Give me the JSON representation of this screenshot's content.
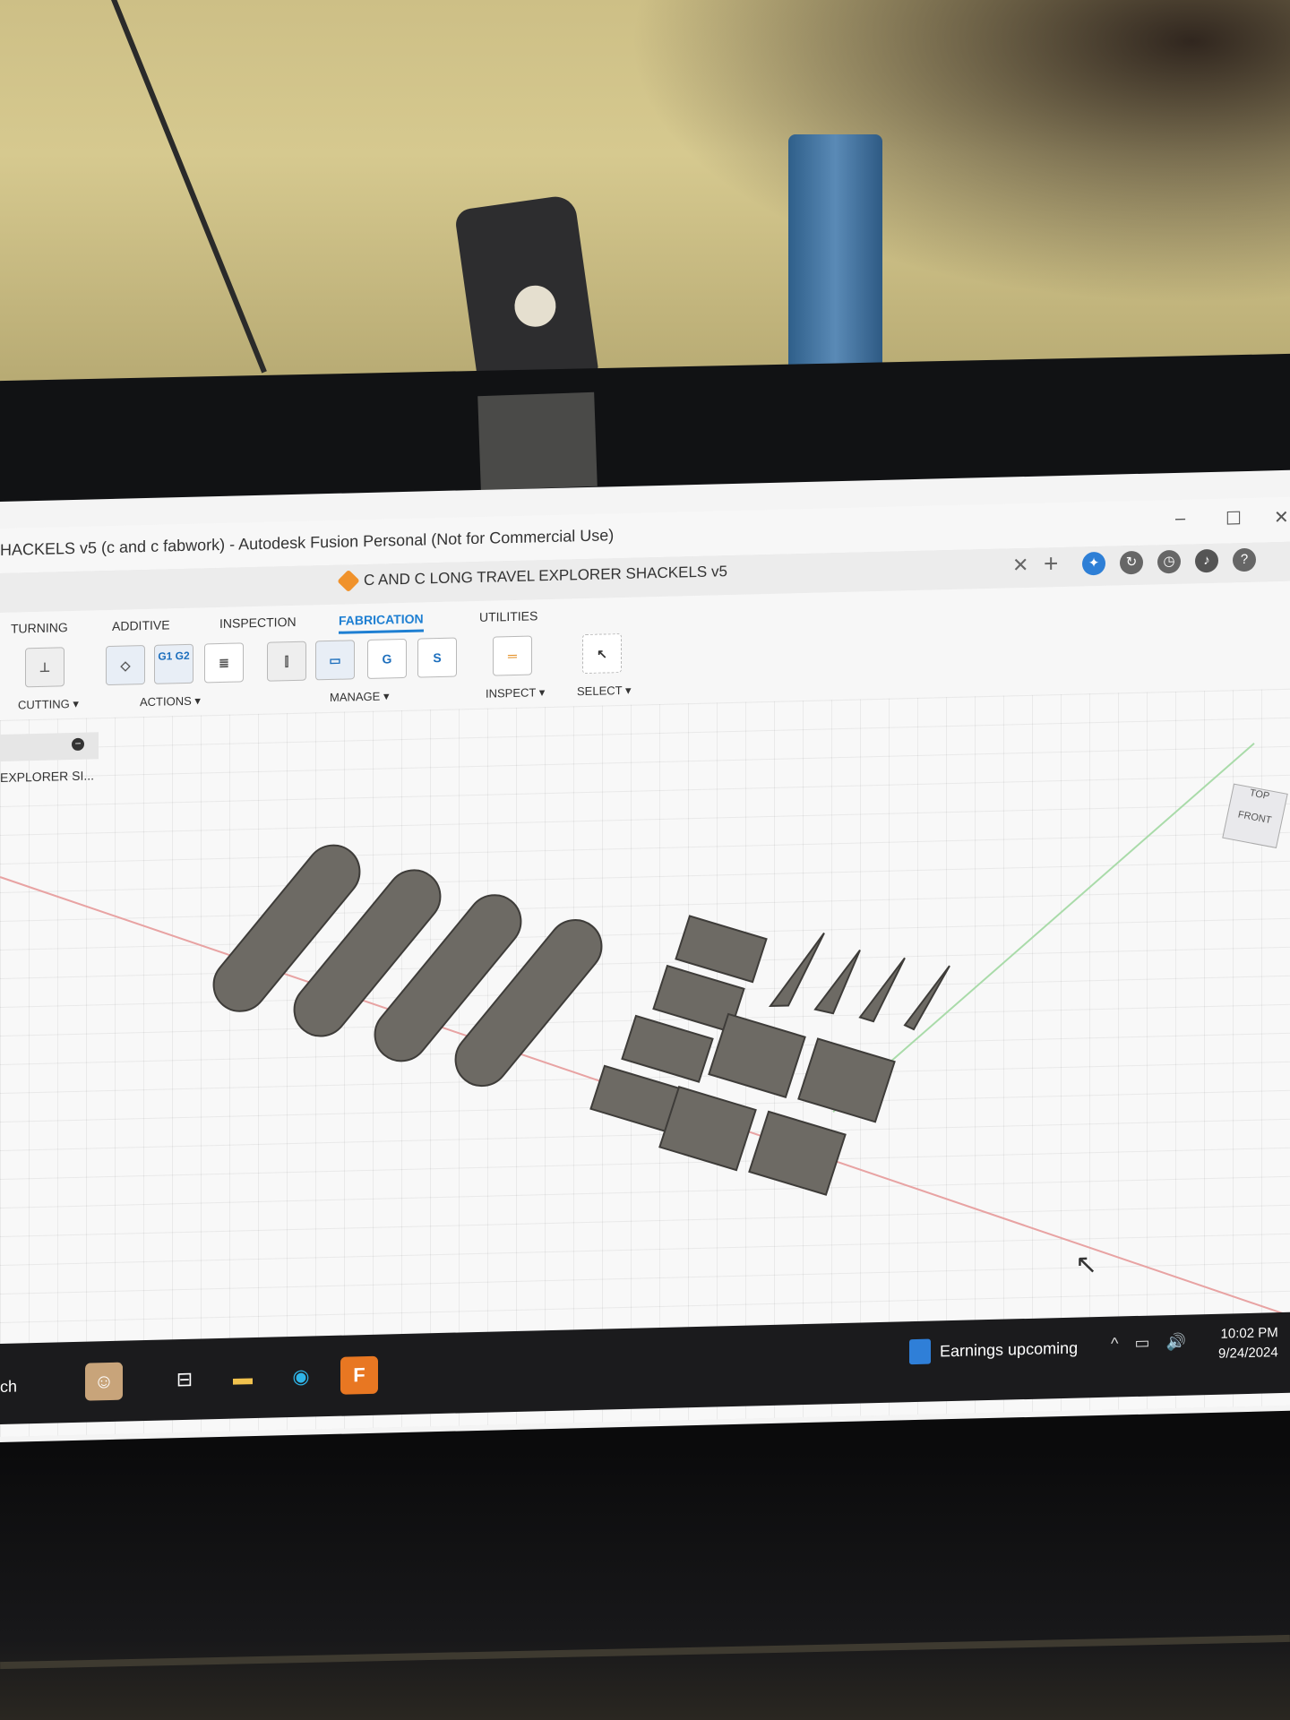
{
  "window": {
    "title": "HACKELS v5 (c and c fabwork) - Autodesk Fusion Personal (Not for Commercial Use)",
    "controls": {
      "minimize": "–",
      "maximize": "☐",
      "close": "✕"
    }
  },
  "document_tab": {
    "name": "C AND C LONG TRAVEL EXPLORER SHACKELS v5",
    "close": "✕",
    "new_tab": "+",
    "header_icons": [
      "extensions-icon",
      "job-status-icon",
      "history-icon",
      "notifications-icon",
      "help-icon"
    ]
  },
  "ribbon": {
    "tabs": [
      {
        "label": "TURNING",
        "active": false
      },
      {
        "label": "ADDITIVE",
        "active": false
      },
      {
        "label": "INSPECTION",
        "active": false
      },
      {
        "label": "FABRICATION",
        "active": true
      },
      {
        "label": "UTILITIES",
        "active": false
      }
    ],
    "groups": {
      "cutting": "CUTTING ▾",
      "actions": "ACTIONS ▾",
      "manage": "MANAGE ▾",
      "inspect": "INSPECT ▾",
      "select": "SELECT ▾"
    },
    "tool_text": {
      "g1g2": "G1 G2",
      "g_post": "G",
      "s_sheet": "S"
    }
  },
  "browser": {
    "collapse": "−",
    "item": "EXPLORER SI..."
  },
  "viewcube": {
    "top": "TOP",
    "front": "FRONT"
  },
  "taskbar": {
    "search_fragment": "ch",
    "news_text": "Earnings upcoming",
    "time": "10:02 PM",
    "date": "9/24/2024",
    "app_fusion_label": "F"
  }
}
